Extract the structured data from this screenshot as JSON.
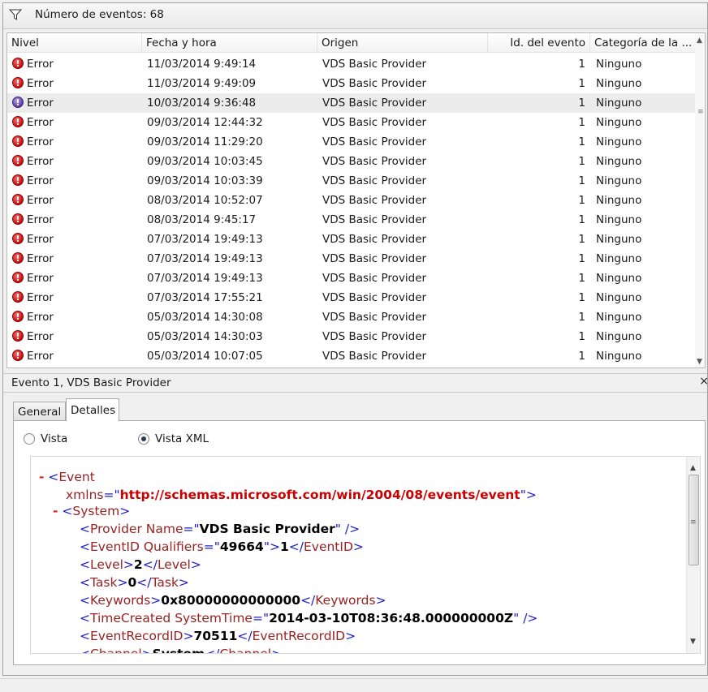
{
  "filter": {
    "icon": "filter-icon",
    "text": "Número de eventos: 68"
  },
  "columns": {
    "level": "Nivel",
    "date": "Fecha y hora",
    "source": "Origen",
    "id": "Id. del evento",
    "category": "Categoría de la ..."
  },
  "rows": [
    {
      "level": "Error",
      "date": "11/03/2014 9:49:14",
      "source": "VDS Basic Provider",
      "id": "1",
      "category": "Ninguno"
    },
    {
      "level": "Error",
      "date": "11/03/2014 9:49:09",
      "source": "VDS Basic Provider",
      "id": "1",
      "category": "Ninguno"
    },
    {
      "level": "Error",
      "date": "10/03/2014 9:36:48",
      "source": "VDS Basic Provider",
      "id": "1",
      "category": "Ninguno"
    },
    {
      "level": "Error",
      "date": "09/03/2014 12:44:32",
      "source": "VDS Basic Provider",
      "id": "1",
      "category": "Ninguno"
    },
    {
      "level": "Error",
      "date": "09/03/2014 11:29:20",
      "source": "VDS Basic Provider",
      "id": "1",
      "category": "Ninguno"
    },
    {
      "level": "Error",
      "date": "09/03/2014 10:03:45",
      "source": "VDS Basic Provider",
      "id": "1",
      "category": "Ninguno"
    },
    {
      "level": "Error",
      "date": "09/03/2014 10:03:39",
      "source": "VDS Basic Provider",
      "id": "1",
      "category": "Ninguno"
    },
    {
      "level": "Error",
      "date": "08/03/2014 10:52:07",
      "source": "VDS Basic Provider",
      "id": "1",
      "category": "Ninguno"
    },
    {
      "level": "Error",
      "date": "08/03/2014 9:45:17",
      "source": "VDS Basic Provider",
      "id": "1",
      "category": "Ninguno"
    },
    {
      "level": "Error",
      "date": "07/03/2014 19:49:13",
      "source": "VDS Basic Provider",
      "id": "1",
      "category": "Ninguno"
    },
    {
      "level": "Error",
      "date": "07/03/2014 19:49:13",
      "source": "VDS Basic Provider",
      "id": "1",
      "category": "Ninguno"
    },
    {
      "level": "Error",
      "date": "07/03/2014 19:49:13",
      "source": "VDS Basic Provider",
      "id": "1",
      "category": "Ninguno"
    },
    {
      "level": "Error",
      "date": "07/03/2014 17:55:21",
      "source": "VDS Basic Provider",
      "id": "1",
      "category": "Ninguno"
    },
    {
      "level": "Error",
      "date": "05/03/2014 14:30:08",
      "source": "VDS Basic Provider",
      "id": "1",
      "category": "Ninguno"
    },
    {
      "level": "Error",
      "date": "05/03/2014 14:30:03",
      "source": "VDS Basic Provider",
      "id": "1",
      "category": "Ninguno"
    },
    {
      "level": "Error",
      "date": "05/03/2014 10:07:05",
      "source": "VDS Basic Provider",
      "id": "1",
      "category": "Ninguno"
    }
  ],
  "selected_row": 2,
  "detail": {
    "title": "Evento 1, VDS Basic Provider",
    "close": "×",
    "tabs": [
      "General",
      "Detalles"
    ],
    "active_tab": "Detalles",
    "radio_vista": "Vista",
    "radio_xml": "Vista XML",
    "selected_view": "Vista XML"
  },
  "xml": {
    "minus": "-",
    "event_tag": "Event",
    "xmlns_attr": "xmlns",
    "xmlns_value": "http://schemas.microsoft.com/win/2004/08/events/event",
    "system_tag": "System",
    "provider_tag": "Provider",
    "provider_attr": "Name",
    "provider_value": "VDS Basic Provider",
    "eventid_tag": "EventID",
    "eventid_attr": "Qualifiers",
    "eventid_qual": "49664",
    "eventid_value": "1",
    "level_tag": "Level",
    "level_value": "2",
    "task_tag": "Task",
    "task_value": "0",
    "keywords_tag": "Keywords",
    "keywords_value": "0x80000000000000",
    "timecreated_tag": "TimeCreated",
    "timecreated_attr": "SystemTime",
    "timecreated_value": "2014-03-10T08:36:48.000000000Z",
    "recordid_tag": "EventRecordID",
    "recordid_value": "70511",
    "channel_tag": "Channel",
    "channel_value": "System"
  },
  "colors": {
    "error_icon": "#d11a1a",
    "xml_tag": "#992222",
    "xml_bracket": "#1d1dcc",
    "xml_string": "#cc0000"
  }
}
